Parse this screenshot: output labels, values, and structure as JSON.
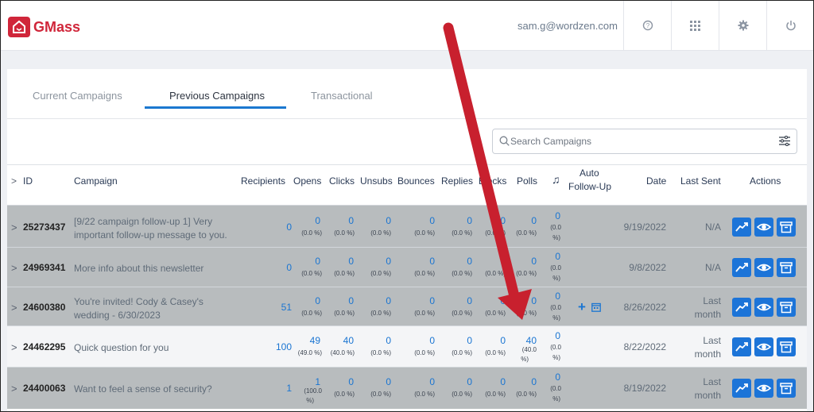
{
  "app": {
    "name": "GMass",
    "user_email": "sam.g@wordzen.com"
  },
  "header_icons": [
    "help-icon",
    "apps-grid-icon",
    "gear-icon",
    "power-icon"
  ],
  "tabs": [
    {
      "label": "Current Campaigns",
      "active": false
    },
    {
      "label": "Previous Campaigns",
      "active": true
    },
    {
      "label": "Transactional",
      "active": false
    }
  ],
  "search": {
    "placeholder": "Search Campaigns"
  },
  "columns": {
    "id": "ID",
    "campaign": "Campaign",
    "recipients": "Recipients",
    "opens": "Opens",
    "clicks": "Clicks",
    "unsubs": "Unsubs",
    "bounces": "Bounces",
    "replies": "Replies",
    "blocks": "Blocks",
    "polls": "Polls",
    "auto_followup_1": "Auto",
    "auto_followup_2": "Follow-Up",
    "date": "Date",
    "last_sent": "Last Sent",
    "actions": "Actions"
  },
  "rows": [
    {
      "id": "25273437",
      "campaign_1": "[9/22 campaign follow-up 1] Very",
      "campaign_2": "important follow-up message to you.",
      "recipients": "0",
      "opens": "0",
      "opens_pct": "(0.0 %)",
      "clicks": "0",
      "clicks_pct": "(0.0 %)",
      "unsubs": "0",
      "unsubs_pct": "(0.0 %)",
      "bounces": "0",
      "bounces_pct": "(0.0 %)",
      "replies": "0",
      "replies_pct": "(0.0 %)",
      "blocks": "0",
      "blocks_pct": "(0.0 %)",
      "polls": "0",
      "polls_pct": "(0.0 %)",
      "music": "0",
      "music_pct_1": "(0.0",
      "music_pct_2": "%)",
      "date": "9/19/2022",
      "last_sent_1": "N/A",
      "last_sent_2": ""
    },
    {
      "id": "24969341",
      "campaign_1": "More info about this newsletter",
      "campaign_2": "",
      "recipients": "0",
      "opens": "0",
      "opens_pct": "(0.0 %)",
      "clicks": "0",
      "clicks_pct": "(0.0 %)",
      "unsubs": "0",
      "unsubs_pct": "(0.0 %)",
      "bounces": "0",
      "bounces_pct": "(0.0 %)",
      "replies": "0",
      "replies_pct": "(0.0 %)",
      "blocks": "0",
      "blocks_pct": "(0.0 %)",
      "polls": "0",
      "polls_pct": "(0.0 %)",
      "music": "0",
      "music_pct_1": "(0.0",
      "music_pct_2": "%)",
      "date": "9/8/2022",
      "last_sent_1": "N/A",
      "last_sent_2": ""
    },
    {
      "id": "24600380",
      "campaign_1": "You're invited! Cody & Casey's",
      "campaign_2": "wedding - 6/30/2023",
      "recipients": "51",
      "opens": "0",
      "opens_pct": "(0.0 %)",
      "clicks": "0",
      "clicks_pct": "(0.0 %)",
      "unsubs": "0",
      "unsubs_pct": "(0.0 %)",
      "bounces": "0",
      "bounces_pct": "(0.0 %)",
      "replies": "0",
      "replies_pct": "(0.0 %)",
      "blocks": "0",
      "blocks_pct": "(0.0 %)",
      "polls": "0",
      "polls_pct": "(0.0 %)",
      "music": "0",
      "music_pct_1": "(0.0",
      "music_pct_2": "%)",
      "date": "8/26/2022",
      "last_sent_1": "Last",
      "last_sent_2": "month"
    },
    {
      "id": "24462295",
      "campaign_1": "Quick question for you",
      "campaign_2": "",
      "recipients": "100",
      "opens": "49",
      "opens_pct": "(49.0 %)",
      "clicks": "40",
      "clicks_pct": "(40.0 %)",
      "unsubs": "0",
      "unsubs_pct": "(0.0 %)",
      "bounces": "0",
      "bounces_pct": "(0.0 %)",
      "replies": "0",
      "replies_pct": "(0.0 %)",
      "blocks": "0",
      "blocks_pct": "(0.0 %)",
      "polls": "40",
      "polls_pct": "(40.0",
      "polls_pct_2": "%)",
      "music": "0",
      "music_pct_1": "(0.0",
      "music_pct_2": "%)",
      "date": "8/22/2022",
      "last_sent_1": "Last",
      "last_sent_2": "month"
    },
    {
      "id": "24400063",
      "campaign_1": "Want to feel a sense of security?",
      "campaign_2": "",
      "recipients": "1",
      "opens": "1",
      "opens_pct": "(100.0",
      "opens_pct_2": "%)",
      "clicks": "0",
      "clicks_pct": "(0.0 %)",
      "unsubs": "0",
      "unsubs_pct": "(0.0 %)",
      "bounces": "0",
      "bounces_pct": "(0.0 %)",
      "replies": "0",
      "replies_pct": "(0.0 %)",
      "blocks": "0",
      "blocks_pct": "(0.0 %)",
      "polls": "0",
      "polls_pct": "(0.0 %)",
      "music": "0",
      "music_pct_1": "(0.0",
      "music_pct_2": "%)",
      "date": "8/19/2022",
      "last_sent_1": "Last",
      "last_sent_2": "month"
    }
  ],
  "colors": {
    "brand": "#d0263a",
    "accent": "#1a75d2",
    "row_highlight": "#b8bcbe",
    "row_plain": "#f4f5f7",
    "arrow": "#c8202e"
  }
}
